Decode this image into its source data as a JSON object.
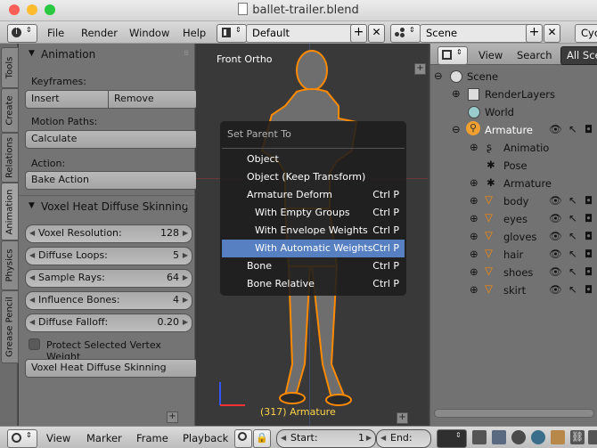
{
  "window": {
    "title": "ballet-trailer.blend"
  },
  "top_header": {
    "menus": [
      "File",
      "Render",
      "Window",
      "Help"
    ],
    "layout": "Default",
    "scene": "Scene",
    "engine_partial": "Cyc"
  },
  "tool_tabs": [
    "Tools",
    "Create",
    "Relations",
    "Animation",
    "Physics",
    "Grease Pencil"
  ],
  "animation_panel": {
    "title": "Animation",
    "keyframes_label": "Keyframes:",
    "insert": "Insert",
    "remove": "Remove",
    "motion_paths_label": "Motion Paths:",
    "calculate": "Calculate",
    "action_label": "Action:",
    "bake_action": "Bake Action"
  },
  "voxel_panel": {
    "title": "Voxel Heat Diffuse Skinning",
    "fields": [
      {
        "name": "Voxel Resolution:",
        "value": "128"
      },
      {
        "name": "Diffuse Loops:",
        "value": "5"
      },
      {
        "name": "Sample Rays:",
        "value": "64"
      },
      {
        "name": "Influence Bones:",
        "value": "4"
      },
      {
        "name": "Diffuse Falloff:",
        "value": "0.20"
      }
    ],
    "protect_checkbox": "Protect Selected Vertex Weight",
    "run_button": "Voxel Heat Diffuse Skinning"
  },
  "viewport": {
    "view_label": "Front Ortho",
    "object_label": "(317) Armature"
  },
  "popup": {
    "title": "Set Parent To",
    "items": [
      {
        "label": "Object",
        "shortcut": ""
      },
      {
        "label": "Object (Keep Transform)",
        "shortcut": ""
      },
      {
        "label": "Armature Deform",
        "shortcut": "Ctrl P"
      },
      {
        "label": "With Empty Groups",
        "shortcut": "Ctrl P"
      },
      {
        "label": "With Envelope Weights",
        "shortcut": "Ctrl P"
      },
      {
        "label": "With Automatic Weights",
        "shortcut": "Ctrl P"
      },
      {
        "label": "Bone",
        "shortcut": "Ctrl P"
      },
      {
        "label": "Bone Relative",
        "shortcut": "Ctrl P"
      }
    ]
  },
  "outliner": {
    "header": [
      "View",
      "Search",
      "All Sce"
    ],
    "rows": [
      "Scene",
      "RenderLayers",
      "World",
      "Armature",
      "Animatio",
      "Pose",
      "Armature",
      "body",
      "eyes",
      "gloves",
      "hair",
      "shoes",
      "skirt"
    ]
  },
  "bottom_bar": {
    "menus": [
      "View",
      "Marker",
      "Frame",
      "Playback"
    ],
    "start_label": "Start:",
    "start_value": "1",
    "end_label": "End:"
  },
  "colors": {
    "highlight": "#5680c2",
    "selection_orange": "#ff8a00",
    "active_bone": "#f0a030"
  }
}
